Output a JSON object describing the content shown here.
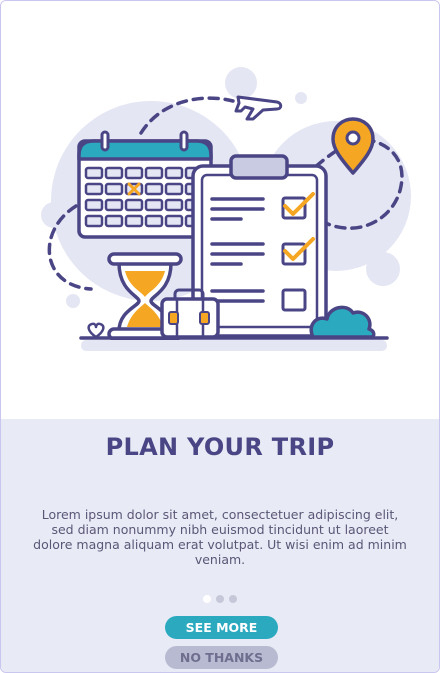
{
  "onboarding": {
    "title": "PLAN YOUR TRIP",
    "description": "Lorem ipsum dolor sit amet, consectetuer adipiscing elit, sed diam nonummy nibh euismod tincidunt ut laoreet dolore magna aliquam erat volutpat. Ut wisi enim ad minim veniam.",
    "pagination": {
      "total": 3,
      "current": 1
    },
    "primary_button": "SEE MORE",
    "secondary_button": "NO THANKS"
  },
  "illustration": {
    "icons": [
      "airplane-icon",
      "calendar-icon",
      "location-pin-icon",
      "clipboard-checklist-icon",
      "hourglass-icon",
      "suitcase-icon",
      "bush-icon",
      "heart-icon"
    ]
  },
  "colors": {
    "primary": "#2aa9bf",
    "title": "#4a4585",
    "accent": "#f5a623",
    "panel_bg": "#e8eaf5",
    "secondary_button": "#b8bad2"
  }
}
